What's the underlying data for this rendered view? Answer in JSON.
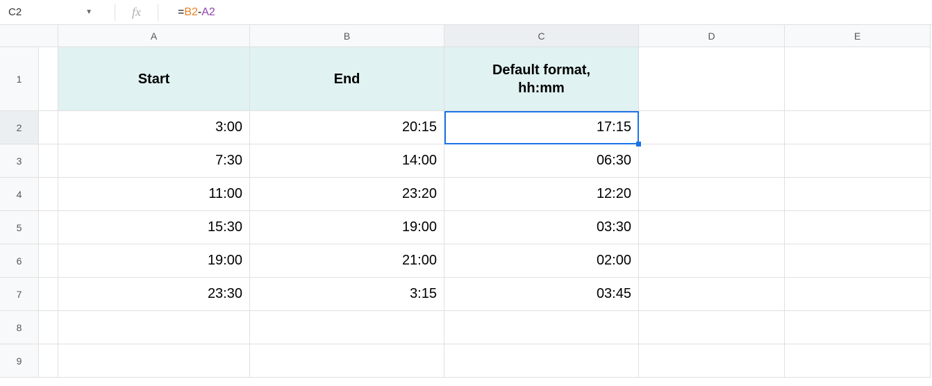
{
  "name_box": "C2",
  "formula": {
    "eq": "=",
    "ref1": "B2",
    "op": "-",
    "ref2": "A2"
  },
  "columns": [
    "A",
    "B",
    "C",
    "D",
    "E"
  ],
  "rows": [
    "1",
    "2",
    "3",
    "4",
    "5",
    "6",
    "7",
    "8",
    "9"
  ],
  "headers": {
    "a": "Start",
    "b": "End",
    "c": "Default format,\nhh:mm"
  },
  "data": [
    {
      "a": "3:00",
      "b": "20:15",
      "c": "17:15"
    },
    {
      "a": "7:30",
      "b": "14:00",
      "c": "06:30"
    },
    {
      "a": "11:00",
      "b": "23:20",
      "c": "12:20"
    },
    {
      "a": "15:30",
      "b": "19:00",
      "c": "03:30"
    },
    {
      "a": "19:00",
      "b": "21:00",
      "c": "02:00"
    },
    {
      "a": "23:30",
      "b": "3:15",
      "c": "03:45"
    }
  ],
  "selected_cell": "C2",
  "chart_data": {
    "type": "table",
    "columns": [
      "Start",
      "End",
      "Default format, hh:mm"
    ],
    "rows": [
      [
        "3:00",
        "20:15",
        "17:15"
      ],
      [
        "7:30",
        "14:00",
        "06:30"
      ],
      [
        "11:00",
        "23:20",
        "12:20"
      ],
      [
        "15:30",
        "19:00",
        "03:30"
      ],
      [
        "19:00",
        "21:00",
        "02:00"
      ],
      [
        "23:30",
        "3:15",
        "03:45"
      ]
    ]
  }
}
